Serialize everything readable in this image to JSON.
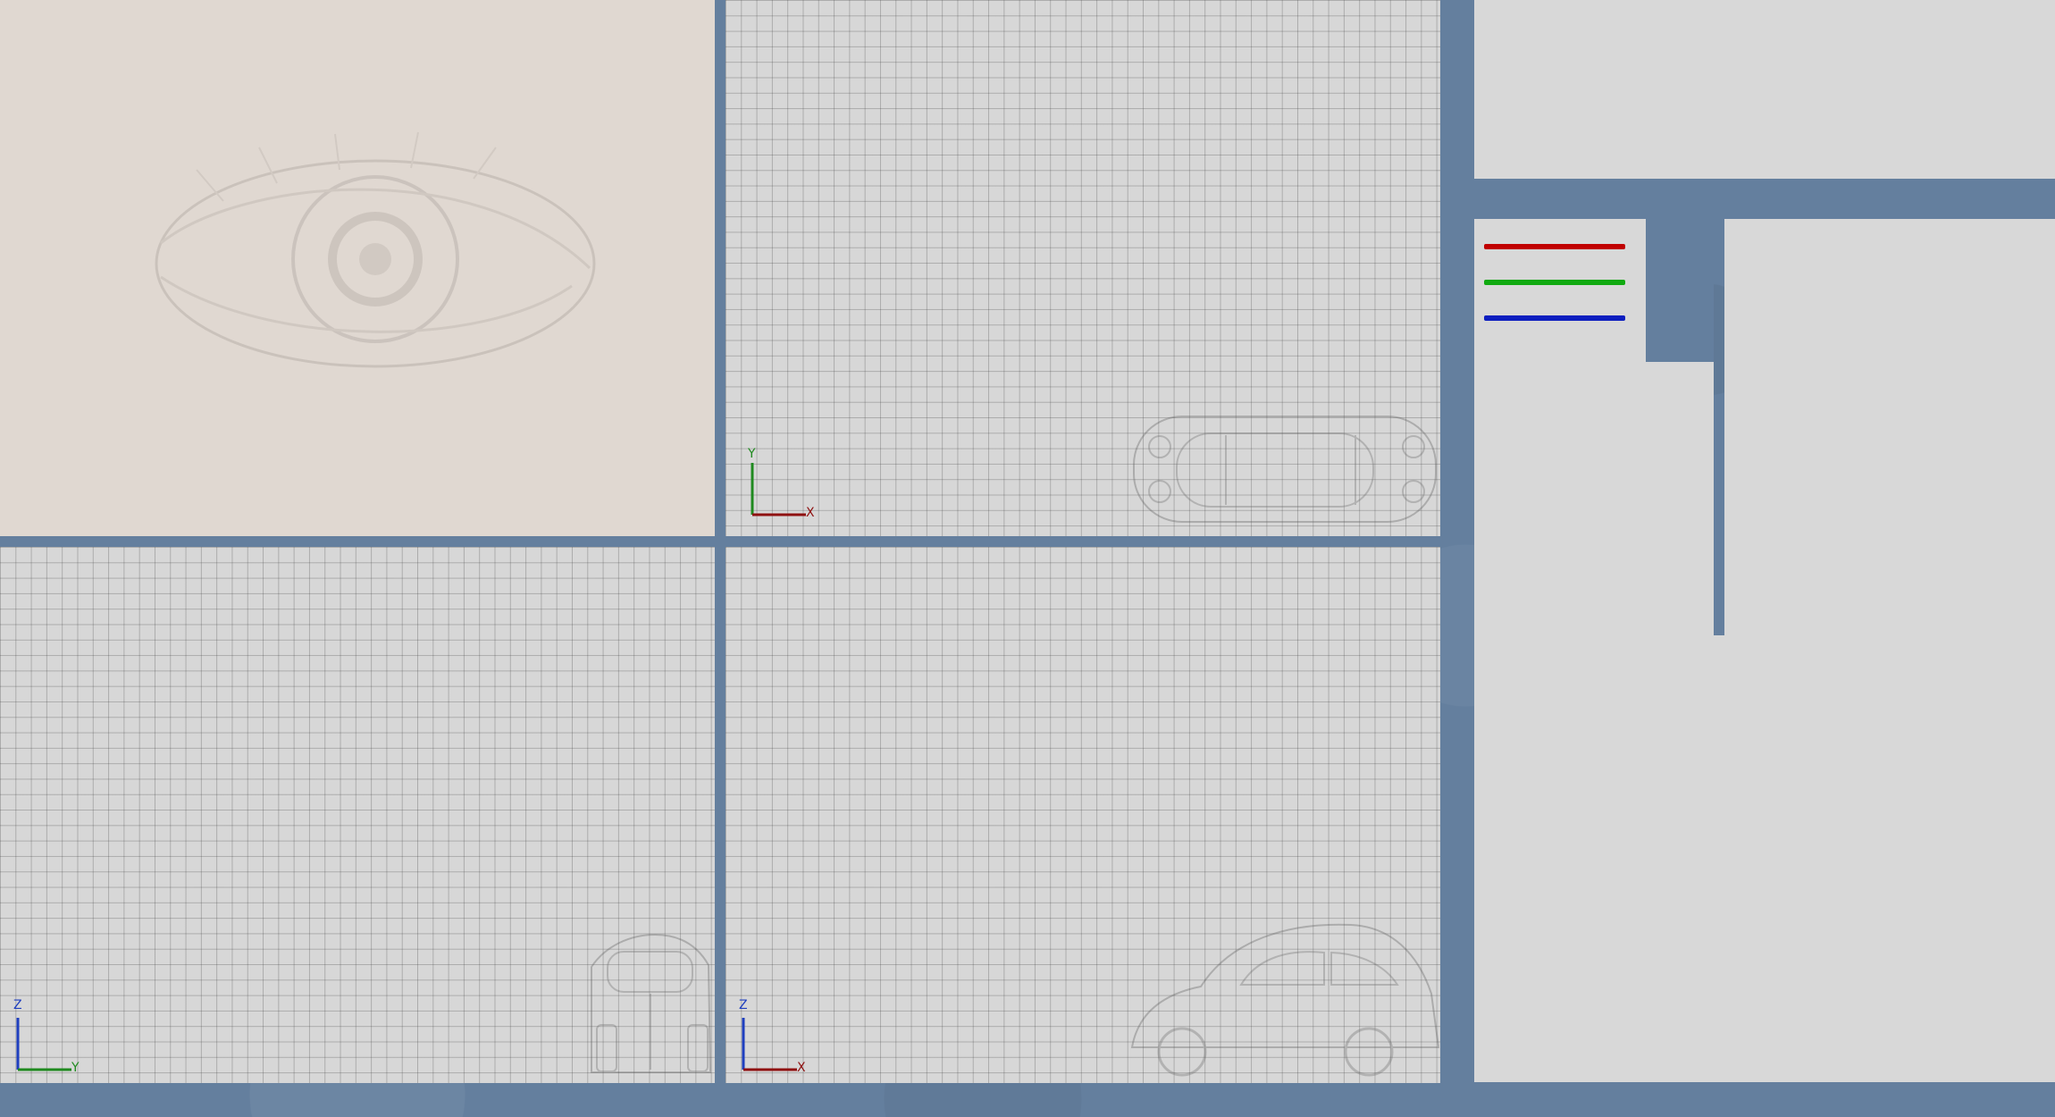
{
  "viewports": {
    "perspective": {
      "background_color": "#e0d8d1"
    },
    "top": {
      "axes": {
        "vertical": "Y",
        "horizontal": "X"
      },
      "vertical_color": "#1f8a1f",
      "horizontal_color": "#8f1111"
    },
    "side": {
      "axes": {
        "vertical": "Z",
        "horizontal": "Y"
      },
      "vertical_color": "#1f3fbf",
      "horizontal_color": "#1f8a1f"
    },
    "front": {
      "axes": {
        "vertical": "Z",
        "horizontal": "X"
      },
      "vertical_color": "#1f3fbf",
      "horizontal_color": "#8f1111"
    }
  },
  "palette": {
    "lines": [
      {
        "name": "red",
        "color": "#c00000"
      },
      {
        "name": "green",
        "color": "#11aa11"
      },
      {
        "name": "blue",
        "color": "#0d1ebf"
      }
    ]
  },
  "theme": {
    "workspace_background": "#647f9e",
    "panel_background": "#d8d8d8"
  }
}
